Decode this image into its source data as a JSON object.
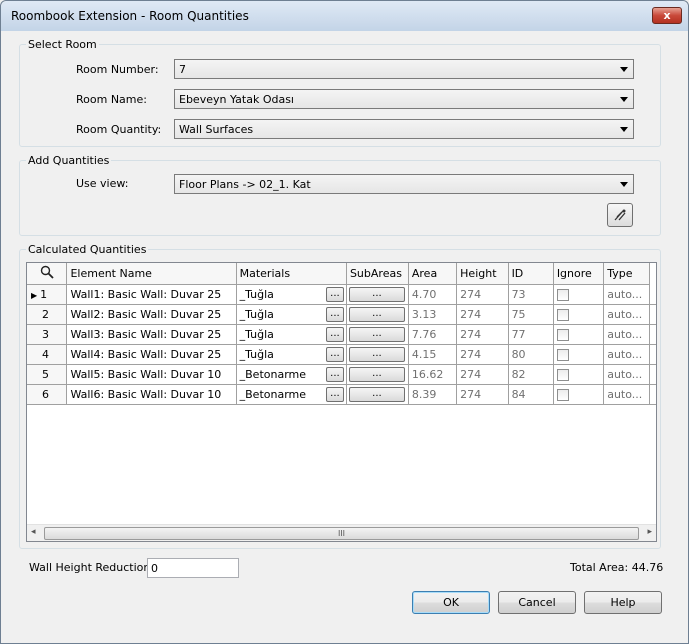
{
  "window": {
    "title": "Roombook Extension - Room Quantities",
    "close_glyph": "x"
  },
  "select_room": {
    "group_label": "Select Room",
    "room_number_label": "Room Number:",
    "room_number_value": "7",
    "room_name_label": "Room Name:",
    "room_name_value": "Ebeveyn Yatak Odası",
    "room_quantity_label": "Room Quantity:",
    "room_quantity_value": "Wall Surfaces"
  },
  "add_quantities": {
    "group_label": "Add Quantities",
    "use_view_label": "Use view:",
    "use_view_value": "Floor Plans -> 02_1. Kat",
    "pick_button_icon": "pick-tool-icon"
  },
  "calculated": {
    "group_label": "Calculated Quantities",
    "columns": [
      "Element Name",
      "Materials",
      "SubAreas",
      "Area",
      "Height",
      "ID",
      "Ignore",
      "Type"
    ],
    "header_icon": "search-icon",
    "cell_button_label": "...",
    "current_row_marker": "▶",
    "rows": [
      {
        "num": "1",
        "element": "Wall1: Basic Wall: Duvar 25",
        "material": "_Tuğla",
        "area": "4.70",
        "height": "274",
        "id": "73",
        "ignore": false,
        "type": "auto..."
      },
      {
        "num": "2",
        "element": "Wall2: Basic Wall: Duvar 25",
        "material": "_Tuğla",
        "area": "3.13",
        "height": "274",
        "id": "75",
        "ignore": false,
        "type": "auto..."
      },
      {
        "num": "3",
        "element": "Wall3: Basic Wall: Duvar 25",
        "material": "_Tuğla",
        "area": "7.76",
        "height": "274",
        "id": "77",
        "ignore": false,
        "type": "auto..."
      },
      {
        "num": "4",
        "element": "Wall4: Basic Wall: Duvar 25",
        "material": "_Tuğla",
        "area": "4.15",
        "height": "274",
        "id": "80",
        "ignore": false,
        "type": "auto..."
      },
      {
        "num": "5",
        "element": "Wall5: Basic Wall: Duvar 10",
        "material": "_Betonarme",
        "area": "16.62",
        "height": "274",
        "id": "82",
        "ignore": false,
        "type": "auto..."
      },
      {
        "num": "6",
        "element": "Wall6: Basic Wall: Duvar 10",
        "material": "_Betonarme",
        "area": "8.39",
        "height": "274",
        "id": "84",
        "ignore": false,
        "type": "auto..."
      }
    ],
    "scroll_left": "◂",
    "scroll_right": "▸",
    "scroll_grip": "III"
  },
  "footer": {
    "wall_height_reduction_label": "Wall Height Reduction",
    "wall_height_reduction_value": "0",
    "total_area_text": "Total Area: 44.76",
    "ok_label": "OK",
    "cancel_label": "Cancel",
    "help_label": "Help"
  }
}
